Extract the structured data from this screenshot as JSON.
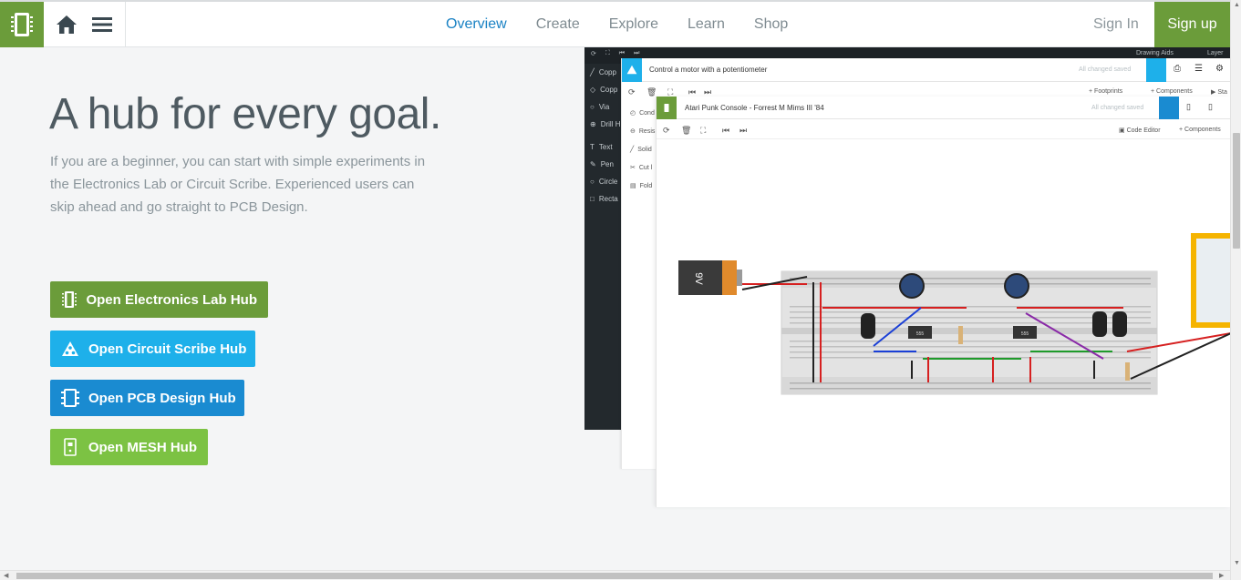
{
  "nav": {
    "links": [
      {
        "label": "Overview",
        "active": true
      },
      {
        "label": "Create",
        "active": false
      },
      {
        "label": "Explore",
        "active": false
      },
      {
        "label": "Learn",
        "active": false
      },
      {
        "label": "Shop",
        "active": false
      }
    ],
    "sign_in": "Sign In",
    "sign_up": "Sign up"
  },
  "hero": {
    "title": "A hub for every goal.",
    "description": "If you are a beginner, you can start with simple experiments in the Electronics Lab or Circuit Scribe. Experienced users can skip ahead and go straight to PCB Design."
  },
  "hubs": {
    "electronics_lab": "Open Electronics Lab Hub",
    "circuit_scribe": "Open Circuit Scribe Hub",
    "pcb_design": "Open PCB Design Hub",
    "mesh": "Open MESH Hub"
  },
  "preview": {
    "pcb_toolbar": {
      "drawing_aids": "Drawing Aids",
      "layers": "Layer"
    },
    "pcb_tools": [
      "Copp",
      "Copp",
      "Via",
      "Drill H",
      "Text",
      "Pen",
      "Circle",
      "Recta"
    ],
    "circuit_scribe": {
      "title": "Control a motor with a potentiometer",
      "saved": "All changed saved",
      "footprints": "Footprints",
      "components": "Components",
      "start": "Sta",
      "tools": [
        "Cond",
        "Resis",
        "Solid",
        "Cut l",
        "Fold"
      ]
    },
    "electronics_lab": {
      "title": "Atari Punk Console - Forrest M Mims III '84",
      "saved": "All changed saved",
      "code_editor": "Code Editor",
      "components": "Components",
      "battery_label": "9V",
      "chip_label": "555"
    }
  },
  "colors": {
    "brand_green": "#6b9c3a",
    "circuit_scribe_blue": "#1eb0ea",
    "pcb_blue": "#1a8bd1",
    "mesh_green": "#7cc243",
    "nav_active": "#1a82c4"
  }
}
